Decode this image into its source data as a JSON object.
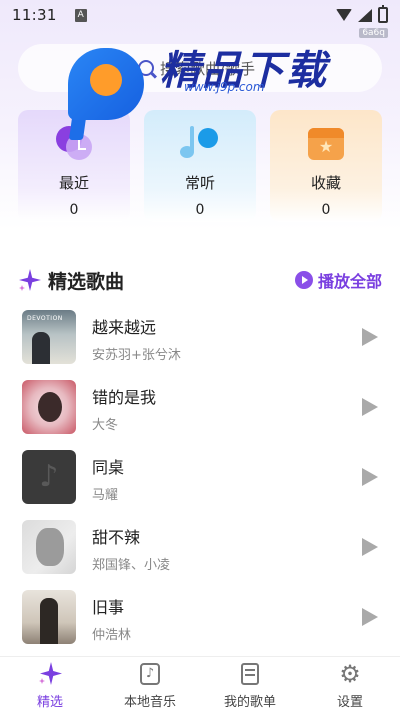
{
  "status_bar": {
    "time": "11:31",
    "notification_letter": "A",
    "corner_tag": "6a6q"
  },
  "watermark": {
    "title": "精品下载",
    "url": "www.j9p.com"
  },
  "search": {
    "placeholder": "搜索歌曲/歌手"
  },
  "cards": [
    {
      "label": "最近",
      "count": "0",
      "icon": "recent-clock-icon",
      "color": "#8a3fe0"
    },
    {
      "label": "常听",
      "count": "0",
      "icon": "music-note-icon",
      "color": "#1b9be8"
    },
    {
      "label": "收藏",
      "count": "0",
      "icon": "favorite-box-icon",
      "color": "#f5a24a"
    }
  ],
  "section": {
    "title": "精选歌曲",
    "play_all": "播放全部",
    "accent": "#7a3fe0"
  },
  "songs": [
    {
      "title": "越来越远",
      "artist": "安苏羽+张兮沐",
      "cover_text": "DEVOTION"
    },
    {
      "title": "错的是我",
      "artist": "大冬"
    },
    {
      "title": "同桌",
      "artist": "马耀"
    },
    {
      "title": "甜不辣",
      "artist": "郑国锋、小凌"
    },
    {
      "title": "旧事",
      "artist": "仲浩林"
    }
  ],
  "nav": [
    {
      "label": "精选",
      "icon": "sparkle-icon",
      "active": true
    },
    {
      "label": "本地音乐",
      "icon": "local-music-icon",
      "active": false
    },
    {
      "label": "我的歌单",
      "icon": "playlist-icon",
      "active": false
    },
    {
      "label": "设置",
      "icon": "gear-icon",
      "active": false
    }
  ]
}
